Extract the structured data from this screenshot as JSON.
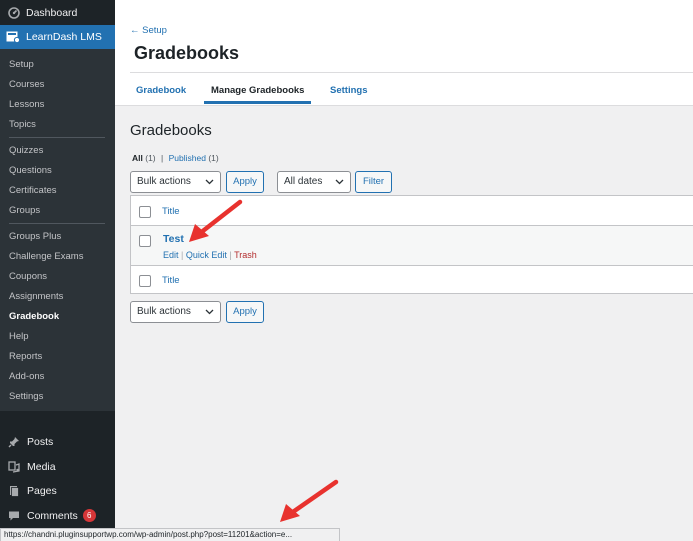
{
  "sidebar": {
    "dashboard": "Dashboard",
    "learndash": "LearnDash LMS",
    "groups": [
      [
        "Setup",
        "Courses",
        "Lessons",
        "Topics"
      ],
      [
        "Quizzes",
        "Questions",
        "Certificates",
        "Groups"
      ],
      [
        "Groups Plus",
        "Challenge Exams",
        "Coupons",
        "Assignments",
        "Gradebook",
        "Help",
        "Reports",
        "Add-ons",
        "Settings"
      ]
    ],
    "current": "Gradebook",
    "bottom": {
      "posts": "Posts",
      "media": "Media",
      "pages": "Pages",
      "comments": "Comments",
      "comments_count": "6"
    }
  },
  "header": {
    "back_link": "← Setup",
    "title": "Gradebooks",
    "tabs": [
      "Gradebook",
      "Manage Gradebooks",
      "Settings"
    ],
    "active_tab": "Manage Gradebooks"
  },
  "content": {
    "title": "Gradebooks",
    "views": {
      "all": "All",
      "all_count": "(1)",
      "separator": "|",
      "published": "Published",
      "published_count": "(1)"
    },
    "bulk_actions": "Bulk actions",
    "apply": "Apply",
    "all_dates": "All dates",
    "filter": "Filter",
    "table": {
      "column_title": "Title",
      "row_title": "Test",
      "actions": {
        "edit": "Edit",
        "sep": "|",
        "quick_edit": "Quick Edit",
        "trash": "Trash"
      }
    }
  },
  "status_url": "https://chandni.pluginsupportwp.com/wp-admin/post.php?post=11201&action=e...",
  "colors": {
    "sidebar_bg": "#1d2327",
    "accent": "#2271b1",
    "arrow": "#e8322e",
    "trash": "#b32d2e"
  }
}
